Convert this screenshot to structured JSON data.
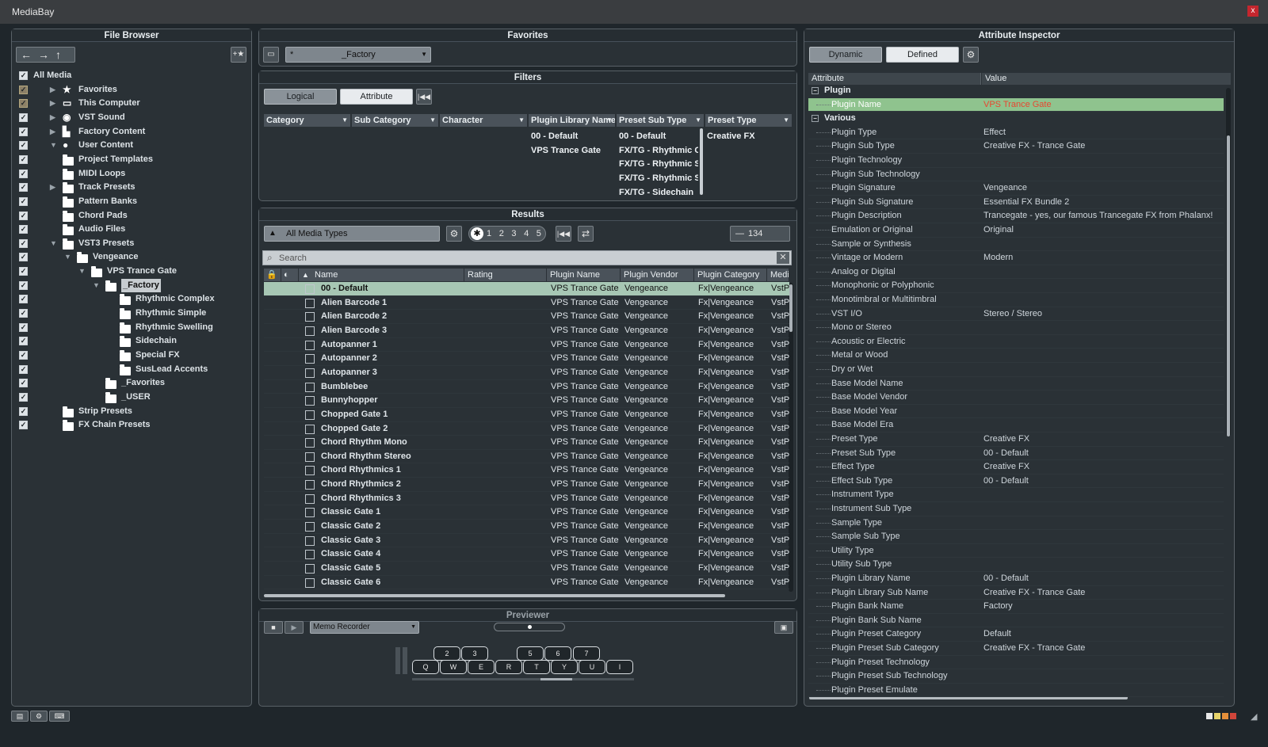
{
  "window": {
    "title": "MediaBay",
    "close": "x"
  },
  "file_browser": {
    "title": "File Browser",
    "tree": [
      {
        "label": "All Media",
        "level": 0,
        "icon": "none",
        "arrow": "",
        "check": "on"
      },
      {
        "label": "Favorites",
        "level": 1,
        "icon": "star-icon",
        "arrow": "▶",
        "check": "dim"
      },
      {
        "label": "This Computer",
        "level": 1,
        "icon": "computer-icon",
        "arrow": "▶",
        "check": "dim"
      },
      {
        "label": "VST Sound",
        "level": 1,
        "icon": "disc-icon",
        "arrow": "▶",
        "check": "on"
      },
      {
        "label": "Factory Content",
        "level": 1,
        "icon": "factory-icon",
        "arrow": "▶",
        "check": "on"
      },
      {
        "label": "User Content",
        "level": 1,
        "icon": "user-icon",
        "arrow": "▼",
        "check": "on"
      },
      {
        "label": "Project Templates",
        "level": 2,
        "icon": "folder-icon",
        "arrow": "",
        "check": "on"
      },
      {
        "label": "MIDI Loops",
        "level": 2,
        "icon": "folder-icon",
        "arrow": "",
        "check": "on"
      },
      {
        "label": "Track Presets",
        "level": 2,
        "icon": "folder-icon",
        "arrow": "▶",
        "check": "on"
      },
      {
        "label": "Pattern Banks",
        "level": 2,
        "icon": "folder-icon",
        "arrow": "",
        "check": "on"
      },
      {
        "label": "Chord Pads",
        "level": 2,
        "icon": "folder-icon",
        "arrow": "",
        "check": "on"
      },
      {
        "label": "Audio Files",
        "level": 2,
        "icon": "folder-icon",
        "arrow": "",
        "check": "on"
      },
      {
        "label": "VST3 Presets",
        "level": 2,
        "icon": "folder-icon",
        "arrow": "▼",
        "check": "on"
      },
      {
        "label": "Vengeance",
        "level": 3,
        "icon": "folder-icon",
        "arrow": "▼",
        "check": "on"
      },
      {
        "label": "VPS Trance Gate",
        "level": 4,
        "icon": "folder-icon",
        "arrow": "▼",
        "check": "on"
      },
      {
        "label": "_Factory",
        "level": 5,
        "icon": "folder-icon",
        "arrow": "▼",
        "check": "on",
        "selected": true
      },
      {
        "label": "Rhythmic Complex",
        "level": 6,
        "icon": "folder-icon",
        "arrow": "",
        "check": "on"
      },
      {
        "label": "Rhythmic Simple",
        "level": 6,
        "icon": "folder-icon",
        "arrow": "",
        "check": "on"
      },
      {
        "label": "Rhythmic Swelling",
        "level": 6,
        "icon": "folder-icon",
        "arrow": "",
        "check": "on"
      },
      {
        "label": "Sidechain",
        "level": 6,
        "icon": "folder-icon",
        "arrow": "",
        "check": "on"
      },
      {
        "label": "Special FX",
        "level": 6,
        "icon": "folder-icon",
        "arrow": "",
        "check": "on"
      },
      {
        "label": "SusLead Accents",
        "level": 6,
        "icon": "folder-icon",
        "arrow": "",
        "check": "on"
      },
      {
        "label": "_Favorites",
        "level": 5,
        "icon": "folder-icon",
        "arrow": "",
        "check": "on"
      },
      {
        "label": "_USER",
        "level": 5,
        "icon": "folder-icon",
        "arrow": "",
        "check": "on"
      },
      {
        "label": "Strip Presets",
        "level": 2,
        "icon": "folder-icon",
        "arrow": "",
        "check": "on"
      },
      {
        "label": "FX Chain Presets",
        "level": 2,
        "icon": "folder-icon",
        "arrow": "",
        "check": "on"
      }
    ]
  },
  "favorites": {
    "title": "Favorites",
    "current": "_Factory",
    "prefix": "*"
  },
  "filters": {
    "title": "Filters",
    "tab_logical": "Logical",
    "tab_attribute": "Attribute",
    "columns": [
      "Category",
      "Sub Category",
      "Character",
      "Plugin Library Name",
      "Preset Sub Type",
      "Preset Type"
    ],
    "plugin_library_values": [
      "00 - Default",
      "VPS Trance Gate"
    ],
    "preset_sub_type_values": [
      "00 - Default",
      "FX/TG - Rhythmic Co",
      "FX/TG - Rhythmic Si",
      "FX/TG - Rhythmic Sw",
      "FX/TG - Sidechain"
    ],
    "preset_type_values": [
      "Creative FX"
    ]
  },
  "results": {
    "title": "Results",
    "media_type": "All Media Types",
    "ratings": [
      "1",
      "2",
      "3",
      "4",
      "5"
    ],
    "count": "134",
    "search_placeholder": "Search",
    "columns": [
      "Name",
      "Rating",
      "Plugin Name",
      "Plugin Vendor",
      "Plugin Category",
      "Media"
    ],
    "rows": [
      {
        "name": "00 - Default",
        "plugin": "VPS Trance Gate",
        "vendor": "Vengeance",
        "category": "Fx|Vengeance",
        "media": "VstP"
      },
      {
        "name": "Alien Barcode 1",
        "plugin": "VPS Trance Gate",
        "vendor": "Vengeance",
        "category": "Fx|Vengeance",
        "media": "VstP"
      },
      {
        "name": "Alien Barcode 2",
        "plugin": "VPS Trance Gate",
        "vendor": "Vengeance",
        "category": "Fx|Vengeance",
        "media": "VstP"
      },
      {
        "name": "Alien Barcode 3",
        "plugin": "VPS Trance Gate",
        "vendor": "Vengeance",
        "category": "Fx|Vengeance",
        "media": "VstP"
      },
      {
        "name": "Autopanner 1",
        "plugin": "VPS Trance Gate",
        "vendor": "Vengeance",
        "category": "Fx|Vengeance",
        "media": "VstP"
      },
      {
        "name": "Autopanner 2",
        "plugin": "VPS Trance Gate",
        "vendor": "Vengeance",
        "category": "Fx|Vengeance",
        "media": "VstP"
      },
      {
        "name": "Autopanner 3",
        "plugin": "VPS Trance Gate",
        "vendor": "Vengeance",
        "category": "Fx|Vengeance",
        "media": "VstP"
      },
      {
        "name": "Bumblebee",
        "plugin": "VPS Trance Gate",
        "vendor": "Vengeance",
        "category": "Fx|Vengeance",
        "media": "VstP"
      },
      {
        "name": "Bunnyhopper",
        "plugin": "VPS Trance Gate",
        "vendor": "Vengeance",
        "category": "Fx|Vengeance",
        "media": "VstP"
      },
      {
        "name": "Chopped Gate 1",
        "plugin": "VPS Trance Gate",
        "vendor": "Vengeance",
        "category": "Fx|Vengeance",
        "media": "VstP"
      },
      {
        "name": "Chopped Gate 2",
        "plugin": "VPS Trance Gate",
        "vendor": "Vengeance",
        "category": "Fx|Vengeance",
        "media": "VstP"
      },
      {
        "name": "Chord Rhythm Mono",
        "plugin": "VPS Trance Gate",
        "vendor": "Vengeance",
        "category": "Fx|Vengeance",
        "media": "VstP"
      },
      {
        "name": "Chord Rhythm Stereo",
        "plugin": "VPS Trance Gate",
        "vendor": "Vengeance",
        "category": "Fx|Vengeance",
        "media": "VstP"
      },
      {
        "name": "Chord Rhythmics 1",
        "plugin": "VPS Trance Gate",
        "vendor": "Vengeance",
        "category": "Fx|Vengeance",
        "media": "VstP"
      },
      {
        "name": "Chord Rhythmics 2",
        "plugin": "VPS Trance Gate",
        "vendor": "Vengeance",
        "category": "Fx|Vengeance",
        "media": "VstP"
      },
      {
        "name": "Chord Rhythmics 3",
        "plugin": "VPS Trance Gate",
        "vendor": "Vengeance",
        "category": "Fx|Vengeance",
        "media": "VstP"
      },
      {
        "name": "Classic Gate 1",
        "plugin": "VPS Trance Gate",
        "vendor": "Vengeance",
        "category": "Fx|Vengeance",
        "media": "VstP"
      },
      {
        "name": "Classic Gate 2",
        "plugin": "VPS Trance Gate",
        "vendor": "Vengeance",
        "category": "Fx|Vengeance",
        "media": "VstP"
      },
      {
        "name": "Classic Gate 3",
        "plugin": "VPS Trance Gate",
        "vendor": "Vengeance",
        "category": "Fx|Vengeance",
        "media": "VstP"
      },
      {
        "name": "Classic Gate 4",
        "plugin": "VPS Trance Gate",
        "vendor": "Vengeance",
        "category": "Fx|Vengeance",
        "media": "VstP"
      },
      {
        "name": "Classic Gate 5",
        "plugin": "VPS Trance Gate",
        "vendor": "Vengeance",
        "category": "Fx|Vengeance",
        "media": "VstP"
      },
      {
        "name": "Classic Gate 6",
        "plugin": "VPS Trance Gate",
        "vendor": "Vengeance",
        "category": "Fx|Vengeance",
        "media": "VstP"
      }
    ]
  },
  "previewer": {
    "title": "Previewer",
    "memo": "Memo Recorder",
    "upper_keys": [
      "2",
      "3",
      "5",
      "6",
      "7"
    ],
    "lower_keys": [
      "Q",
      "W",
      "E",
      "R",
      "T",
      "Y",
      "U",
      "I"
    ]
  },
  "inspector": {
    "title": "Attribute Inspector",
    "tab_dynamic": "Dynamic",
    "tab_defined": "Defined",
    "col_attribute": "Attribute",
    "col_value": "Value",
    "group_plugin": "Plugin",
    "group_various": "Various",
    "plugin_rows": [
      {
        "a": "Plugin Name",
        "v": "VPS Trance Gate"
      }
    ],
    "various_rows": [
      {
        "a": "Plugin Type",
        "v": "Effect"
      },
      {
        "a": "Plugin Sub Type",
        "v": "Creative FX - Trance Gate"
      },
      {
        "a": "Plugin Technology",
        "v": ""
      },
      {
        "a": "Plugin Sub Technology",
        "v": ""
      },
      {
        "a": "Plugin Signature",
        "v": "Vengeance"
      },
      {
        "a": "Plugin Sub Signature",
        "v": "Essential FX Bundle 2"
      },
      {
        "a": "Plugin Description",
        "v": "Trancegate - yes, our famous Trancegate FX from Phalanx!"
      },
      {
        "a": "Emulation or Original",
        "v": "Original"
      },
      {
        "a": "Sample or Synthesis",
        "v": ""
      },
      {
        "a": "Vintage or Modern",
        "v": "Modern"
      },
      {
        "a": "Analog or Digital",
        "v": ""
      },
      {
        "a": "Monophonic or Polyphonic",
        "v": ""
      },
      {
        "a": "Monotimbral or Multitimbral",
        "v": ""
      },
      {
        "a": "VST I/O",
        "v": "Stereo / Stereo"
      },
      {
        "a": "Mono or Stereo",
        "v": ""
      },
      {
        "a": "Acoustic or Electric",
        "v": ""
      },
      {
        "a": "Metal or Wood",
        "v": ""
      },
      {
        "a": "Dry or Wet",
        "v": ""
      },
      {
        "a": "Base Model Name",
        "v": ""
      },
      {
        "a": "Base Model Vendor",
        "v": ""
      },
      {
        "a": "Base Model Year",
        "v": ""
      },
      {
        "a": "Base Model Era",
        "v": ""
      },
      {
        "a": "Preset Type",
        "v": "Creative FX"
      },
      {
        "a": "Preset Sub Type",
        "v": "00 - Default"
      },
      {
        "a": "Effect Type",
        "v": "Creative FX"
      },
      {
        "a": "Effect Sub Type",
        "v": "00 - Default"
      },
      {
        "a": "Instrument Type",
        "v": ""
      },
      {
        "a": "Instrument Sub Type",
        "v": ""
      },
      {
        "a": "Sample Type",
        "v": ""
      },
      {
        "a": "Sample Sub Type",
        "v": ""
      },
      {
        "a": "Utility Type",
        "v": ""
      },
      {
        "a": "Utility Sub Type",
        "v": ""
      },
      {
        "a": "Plugin Library Name",
        "v": "00 - Default"
      },
      {
        "a": "Plugin Library Sub Name",
        "v": "Creative FX - Trance Gate"
      },
      {
        "a": "Plugin Bank Name",
        "v": "Factory"
      },
      {
        "a": "Plugin Bank Sub Name",
        "v": ""
      },
      {
        "a": "Plugin Preset Category",
        "v": "Default"
      },
      {
        "a": "Plugin Preset Sub Category",
        "v": "Creative FX - Trance Gate"
      },
      {
        "a": "Plugin Preset Technology",
        "v": ""
      },
      {
        "a": "Plugin Preset Sub Technology",
        "v": ""
      },
      {
        "a": "Plugin Preset Emulate",
        "v": ""
      }
    ]
  },
  "colors": {
    "accent_selected_row": "#a7c7b4",
    "inspector_selected": "#8fc38e",
    "selected_value_text": "#e84630"
  }
}
